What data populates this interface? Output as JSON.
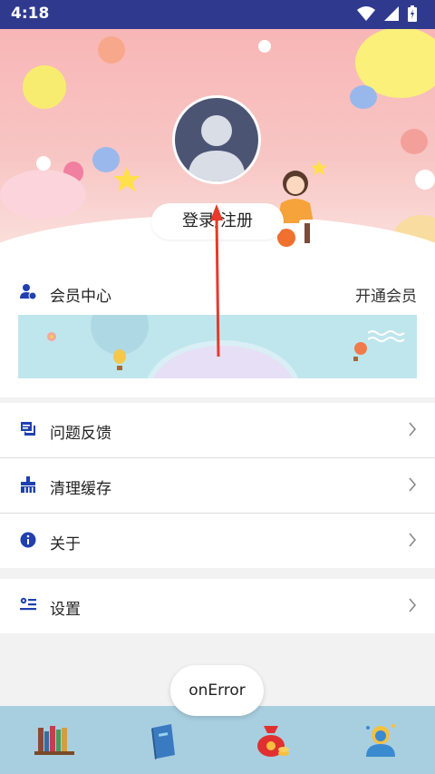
{
  "status_bar": {
    "time": "4:18",
    "icons": [
      "wifi-icon",
      "signal-icon",
      "battery-icon"
    ]
  },
  "header": {
    "login_button": "登录/注册",
    "avatar_icon": "default-avatar-icon"
  },
  "member": {
    "title": "会员中心",
    "action": "开通会员",
    "icon": "member-icon"
  },
  "menu": {
    "feedback": {
      "label": "问题反馈",
      "icon": "feedback-icon"
    },
    "clear_cache": {
      "label": "清理缓存",
      "icon": "broom-icon"
    },
    "about": {
      "label": "关于",
      "icon": "info-icon"
    },
    "settings": {
      "label": "设置",
      "icon": "settings-list-icon"
    }
  },
  "toast": "onError",
  "bottom_nav": {
    "items": [
      "bookshelf-icon",
      "book-icon",
      "money-bag-icon",
      "user-icon"
    ]
  },
  "colors": {
    "status_bar": "#2f3a8f",
    "accent_blue": "#2040b0",
    "bottom_nav": "#a8cfe0",
    "arrow": "#e53a2c"
  }
}
